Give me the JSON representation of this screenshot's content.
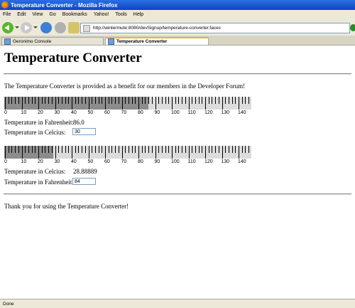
{
  "window": {
    "title": "Temperature Converter - Mozilla Firefox"
  },
  "menu": [
    "File",
    "Edit",
    "View",
    "Go",
    "Bookmarks",
    "Yahoo!",
    "Tools",
    "Help"
  ],
  "url": "http://wintermute:8080/devSignup/temperature-converter.faces",
  "tabs": [
    {
      "label": "Geronimo Console"
    },
    {
      "label": "Temperature Converter"
    }
  ],
  "page": {
    "heading": "Temperature Converter",
    "intro": "The Temperature Converter is provided as a benefit for our members in the Developer Forum!",
    "converter1": {
      "scale_labels": [
        "0",
        "10",
        "20",
        "30",
        "40",
        "50",
        "60",
        "70",
        "80",
        "90",
        "100",
        "110",
        "120",
        "130",
        "140"
      ],
      "fill_value": 86,
      "result_label": "Temperature in Fahrenheit:",
      "result_value": "86.0",
      "input_label": "Temperature in Celcius:",
      "input_value": "30"
    },
    "converter2": {
      "scale_labels": [
        "0",
        "10",
        "20",
        "30",
        "40",
        "50",
        "60",
        "70",
        "80",
        "90",
        "100",
        "110",
        "120",
        "130",
        "140"
      ],
      "fill_value": 28.88889,
      "result_label": "Temperature in Celcius:",
      "result_value": "28.88889",
      "input_label": "Temperature in Fahrenheit:",
      "input_value": "84"
    },
    "closing": "Thank you for using the Temperature Converter!"
  },
  "status": "Done"
}
